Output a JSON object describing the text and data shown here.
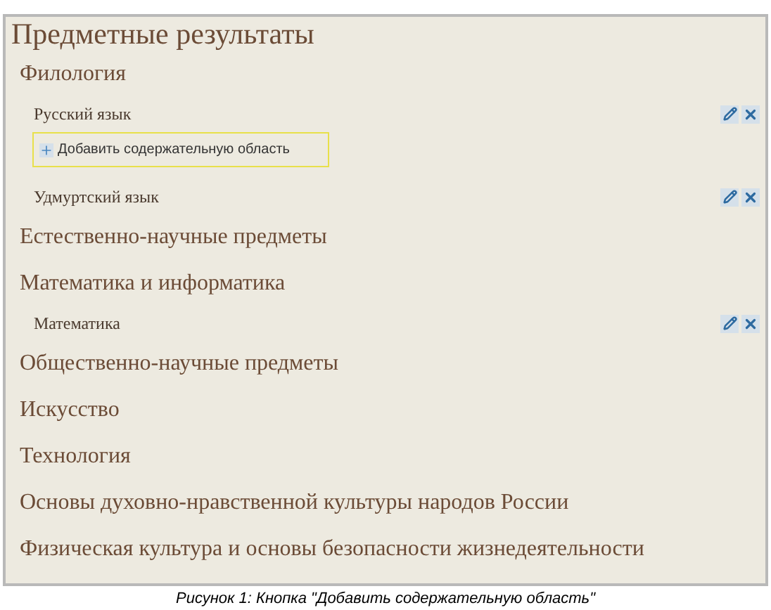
{
  "title": "Предметные результаты",
  "areas": [
    {
      "name": "Филология",
      "subjects": [
        {
          "name": "Русский язык",
          "add_button": "Добавить содержательную область"
        },
        {
          "name": "Удмуртский язык"
        }
      ]
    },
    {
      "name": "Естественно-научные предметы"
    },
    {
      "name": "Математика и информатика",
      "subjects": [
        {
          "name": "Математика"
        }
      ]
    },
    {
      "name": "Общественно-научные предметы"
    },
    {
      "name": "Искусство"
    },
    {
      "name": "Технология"
    },
    {
      "name": "Основы духовно-нравственной культуры народов России"
    },
    {
      "name": "Физическая культура и основы безопасности жизнедеятельности"
    }
  ],
  "caption": "Рисунок 1: Кнопка \"Добавить содержательную область\""
}
